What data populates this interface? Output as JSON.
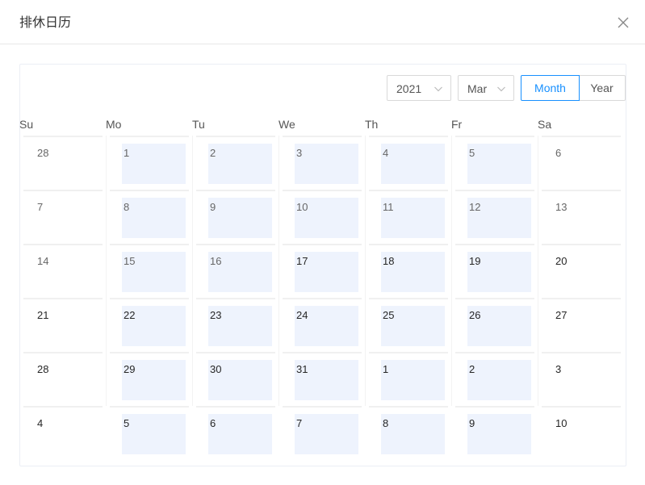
{
  "modal": {
    "title": "排休日历"
  },
  "icons": {
    "close": "close-icon",
    "chevron": "chevron-down-icon"
  },
  "colors": {
    "accent": "#1890ff",
    "workday_bg": "#eef3fd"
  },
  "header": {
    "year": "2021",
    "month": "Mar",
    "mode_month": "Month",
    "mode_year": "Year",
    "active_mode": "Month"
  },
  "weekdays": [
    "Su",
    "Mo",
    "Tu",
    "We",
    "Th",
    "Fr",
    "Sa"
  ],
  "weeks": [
    [
      {
        "day": "28",
        "workday": false,
        "current": false
      },
      {
        "day": "1",
        "workday": true,
        "current": false
      },
      {
        "day": "2",
        "workday": true,
        "current": false
      },
      {
        "day": "3",
        "workday": true,
        "current": false
      },
      {
        "day": "4",
        "workday": true,
        "current": false
      },
      {
        "day": "5",
        "workday": true,
        "current": false
      },
      {
        "day": "6",
        "workday": false,
        "current": false
      }
    ],
    [
      {
        "day": "7",
        "workday": false,
        "current": false
      },
      {
        "day": "8",
        "workday": true,
        "current": false
      },
      {
        "day": "9",
        "workday": true,
        "current": false
      },
      {
        "day": "10",
        "workday": true,
        "current": false
      },
      {
        "day": "11",
        "workday": true,
        "current": false
      },
      {
        "day": "12",
        "workday": true,
        "current": false
      },
      {
        "day": "13",
        "workday": false,
        "current": false
      }
    ],
    [
      {
        "day": "14",
        "workday": false,
        "current": false
      },
      {
        "day": "15",
        "workday": true,
        "current": false
      },
      {
        "day": "16",
        "workday": true,
        "current": false
      },
      {
        "day": "17",
        "workday": true,
        "current": true
      },
      {
        "day": "18",
        "workday": true,
        "current": true
      },
      {
        "day": "19",
        "workday": true,
        "current": true
      },
      {
        "day": "20",
        "workday": false,
        "current": true
      }
    ],
    [
      {
        "day": "21",
        "workday": false,
        "current": true
      },
      {
        "day": "22",
        "workday": true,
        "current": true
      },
      {
        "day": "23",
        "workday": true,
        "current": true
      },
      {
        "day": "24",
        "workday": true,
        "current": true
      },
      {
        "day": "25",
        "workday": true,
        "current": true
      },
      {
        "day": "26",
        "workday": true,
        "current": true
      },
      {
        "day": "27",
        "workday": false,
        "current": true
      }
    ],
    [
      {
        "day": "28",
        "workday": false,
        "current": true
      },
      {
        "day": "29",
        "workday": true,
        "current": true
      },
      {
        "day": "30",
        "workday": true,
        "current": true
      },
      {
        "day": "31",
        "workday": true,
        "current": true
      },
      {
        "day": "1",
        "workday": true,
        "current": true
      },
      {
        "day": "2",
        "workday": true,
        "current": true
      },
      {
        "day": "3",
        "workday": false,
        "current": true
      }
    ],
    [
      {
        "day": "4",
        "workday": false,
        "current": true
      },
      {
        "day": "5",
        "workday": true,
        "current": true
      },
      {
        "day": "6",
        "workday": true,
        "current": true
      },
      {
        "day": "7",
        "workday": true,
        "current": true
      },
      {
        "day": "8",
        "workday": true,
        "current": true
      },
      {
        "day": "9",
        "workday": true,
        "current": true
      },
      {
        "day": "10",
        "workday": false,
        "current": true
      }
    ]
  ]
}
